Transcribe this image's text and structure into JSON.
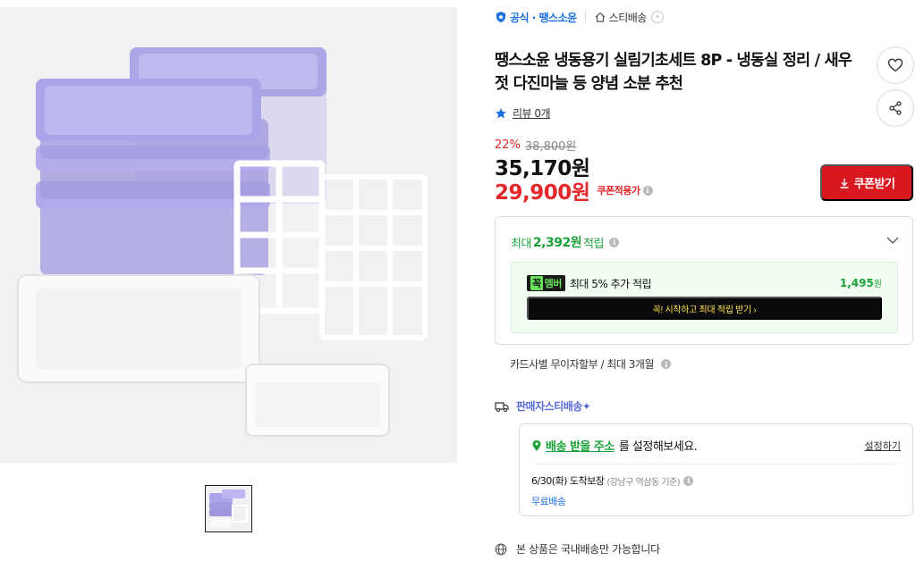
{
  "gallery": {
    "main_image_alt": "",
    "thumbnail_count": 1
  },
  "store": {
    "official_label": "공식 · 땡스소윤",
    "delivery_label": "스티배송",
    "chevron": "›"
  },
  "product": {
    "title": "땡스소윤 냉동용기 실림기초세트 8P - 냉동실 정리 / 새우젓 다진마늘 등 양념 소분 추천",
    "review_label": "리뷰 0개"
  },
  "pricing": {
    "discount_rate": "22%",
    "original_price": "38,800원",
    "sale_price": "35,170원",
    "coupon_price": "29,900원",
    "coupon_price_label": "쿠폰적용가",
    "coupon_button": "쿠폰받기"
  },
  "points": {
    "prefix": "최대",
    "amount": "2,392원",
    "suffix": "적립",
    "member_badge_a": "꼭",
    "member_badge_b": "멤버",
    "member_text": "최대 5% 추가 적립",
    "member_amount": "1,495",
    "member_amount_unit": "원",
    "member_cta": "꼭! 시작하고 최대 적립 받기  ›"
  },
  "installment": {
    "text": "카드사별 무이자할부 / 최대 3개월"
  },
  "delivery": {
    "seller_label": "판매자스티배송✦",
    "address_link": "배송 받을 주소",
    "address_rest": "를 설정해보세요.",
    "set_link": "설정하기",
    "arrival": "6/30(화) 도착보장",
    "arrival_note": "(강남구 역삼동 기준)",
    "free_shipping": "무료배송"
  },
  "notice": {
    "domestic": "본 상품은 국내배송만 가능합니다"
  },
  "colors": {
    "accent_red": "#d9171f",
    "price_red": "#e5262b",
    "points_green": "#1aa13a",
    "link_blue": "#1d6fe0",
    "seller_purple": "#5a6bd6",
    "product_lid": "#a9a3e6"
  },
  "icons": {
    "wishlist": "heart-icon",
    "share": "share-icon",
    "review": "star-icon",
    "coupon": "download-icon",
    "expand": "chevron-down-icon",
    "truck": "truck-icon",
    "location": "pin-icon",
    "globe": "globe-icon"
  }
}
